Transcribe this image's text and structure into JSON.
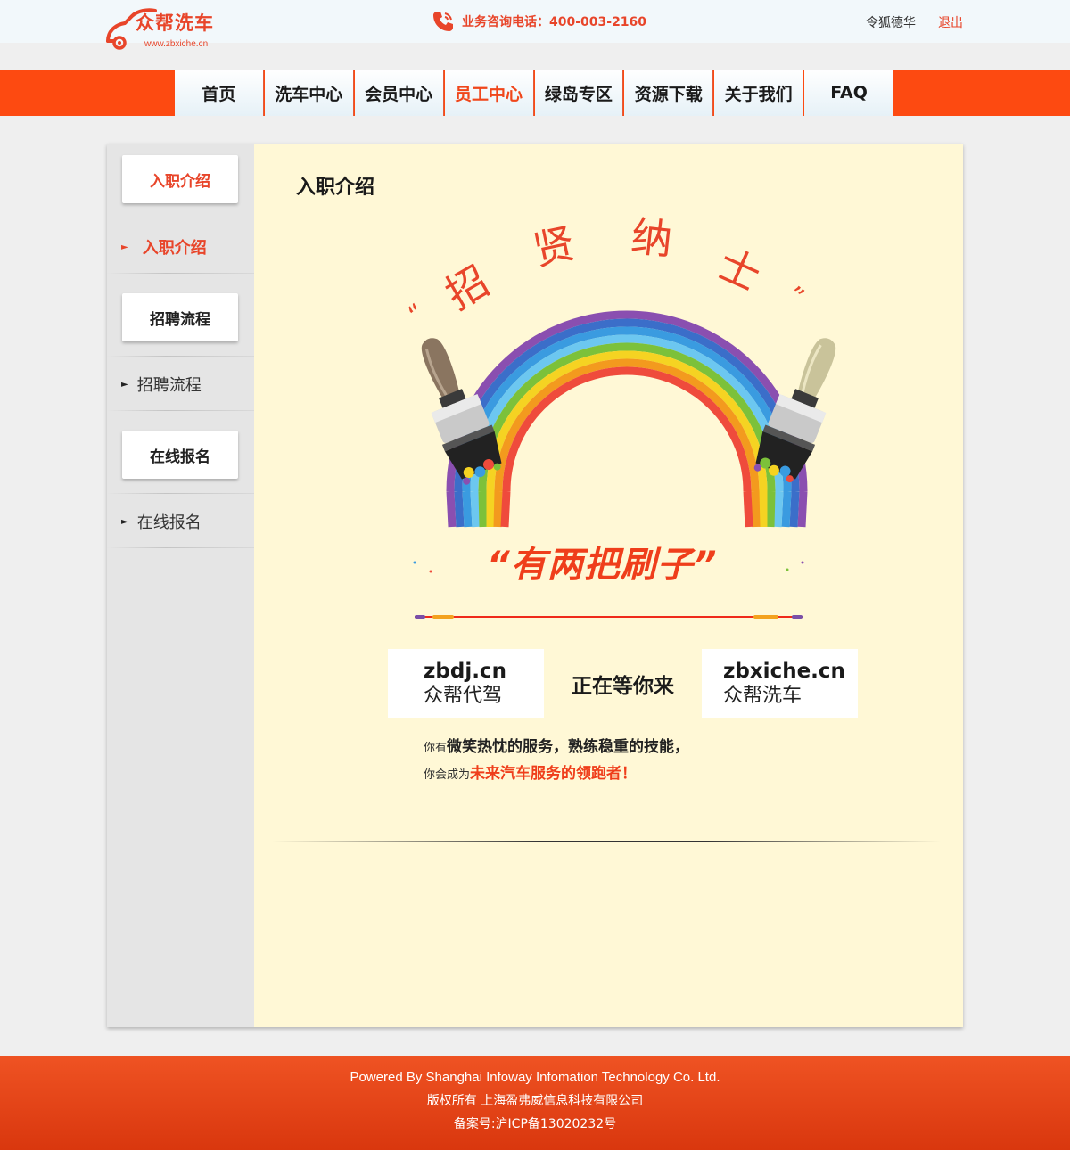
{
  "header": {
    "logo_name": "众帮洗车",
    "logo_url": "www.zbxiche.cn",
    "hotline": "业务咨询电话：400-003-2160",
    "user_name": "令狐德华",
    "logout": "退出"
  },
  "nav": {
    "items": [
      "首页",
      "洗车中心",
      "会员中心",
      "员工中心",
      "绿岛专区",
      "资源下载",
      "关于我们",
      "FAQ"
    ],
    "active": "员工中心"
  },
  "sidebar": {
    "card1": "入职介绍",
    "link1": "入职介绍",
    "card2": "招聘流程",
    "link2": "招聘流程",
    "card3": "在线报名",
    "link3": "在线报名"
  },
  "content": {
    "title": "入职介绍",
    "headline_chars": [
      "“",
      "招",
      "贤",
      "纳",
      "士",
      "”"
    ],
    "slogan": "“有两把刷子”",
    "cards": [
      {
        "domain": "zbdj.cn",
        "brand": "众帮代驾"
      },
      {
        "text": "正在等你来"
      },
      {
        "domain": "zbxiche.cn",
        "brand": "众帮洗车"
      }
    ],
    "line1_prefix": "你有",
    "line1_main": "微笑热忱的服务，熟练稳重的技能，",
    "line2_prefix": "你会成为",
    "line2_highlight": "未来汽车服务的领跑者！"
  },
  "footer": {
    "line1": "Powered By Shanghai Infoway Infomation Technology Co. Ltd.",
    "line2": "版权所有 上海盈弗威信息科技有限公司",
    "line3": "备案号:沪ICP备13020232号"
  },
  "colors": {
    "brand": "#fd4a11",
    "accent_text": "#e8452a",
    "content_bg": "#fff8d6",
    "sidebar_bg": "#e5e5e5"
  }
}
